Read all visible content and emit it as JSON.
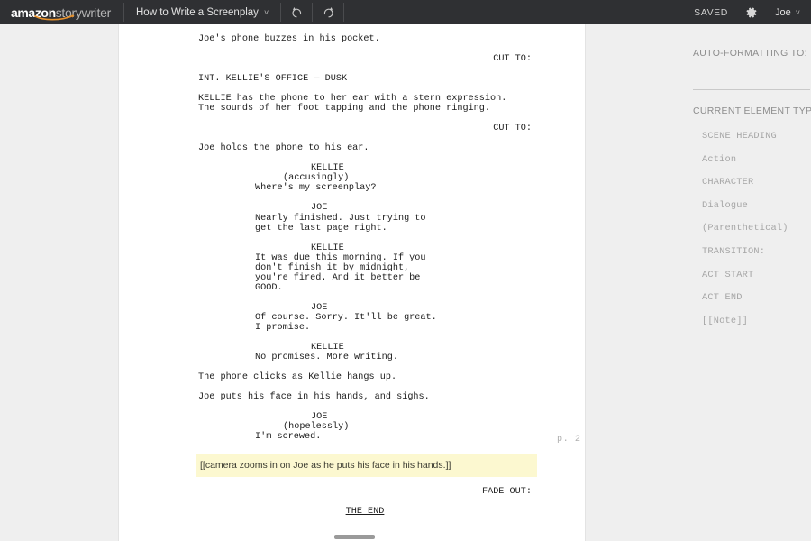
{
  "header": {
    "brand_primary": "amazon",
    "brand_secondary": "storywriter",
    "document_title": "How to Write a Screenplay",
    "title_chevron": "˅",
    "undo_label": "undo-arrow",
    "redo_label": "redo-arrow",
    "save_status": "SAVED",
    "settings_label": "gear",
    "user_name": "Joe",
    "user_chevron": "˅"
  },
  "script": {
    "page_number": "p. 2",
    "lines": [
      {
        "type": "action",
        "text": "Joe's phone buzzes in his pocket."
      },
      {
        "type": "transition",
        "text": "CUT TO:"
      },
      {
        "type": "scene",
        "text": "INT. KELLIE'S OFFICE — DUSK"
      },
      {
        "type": "action",
        "text": "KELLIE has the phone to her ear with a stern expression.\nThe sounds of her foot tapping and the phone ringing."
      },
      {
        "type": "transition",
        "text": "CUT TO:"
      },
      {
        "type": "action",
        "text": "Joe holds the phone to his ear."
      },
      {
        "type": "character",
        "text": "KELLIE"
      },
      {
        "type": "paren",
        "text": "(accusingly)"
      },
      {
        "type": "dialogue",
        "text": "Where's my screenplay?"
      },
      {
        "type": "character",
        "text": "JOE"
      },
      {
        "type": "dialogue",
        "text": "Nearly finished. Just trying to\nget the last page right."
      },
      {
        "type": "character",
        "text": "KELLIE"
      },
      {
        "type": "dialogue",
        "text": "It was due this morning. If you\ndon't finish it by midnight,\nyou're fired. And it better be\nGOOD."
      },
      {
        "type": "character",
        "text": "JOE"
      },
      {
        "type": "dialogue",
        "text": "Of course. Sorry. It'll be great.\nI promise."
      },
      {
        "type": "character",
        "text": "KELLIE"
      },
      {
        "type": "dialogue",
        "text": "No promises. More writing."
      },
      {
        "type": "action",
        "text": "The phone clicks as Kellie hangs up."
      },
      {
        "type": "action",
        "text": "Joe puts his face in his hands, and sighs."
      },
      {
        "type": "character",
        "text": "JOE"
      },
      {
        "type": "paren",
        "text": "(hopelessly)"
      },
      {
        "type": "dialogue",
        "text": "I'm screwed."
      },
      {
        "type": "note",
        "text": "[[camera zooms in on Joe as he puts his face in his hands.]]"
      },
      {
        "type": "transition",
        "text": "FADE OUT:"
      },
      {
        "type": "center_underline",
        "text": "THE END"
      }
    ]
  },
  "sidebar": {
    "auto_formatting_heading": "AUTO-FORMATTING TO:",
    "auto_formatting_value": "",
    "current_element_heading": "CURRENT ELEMENT TYPE",
    "element_types": [
      {
        "label": "SCENE HEADING"
      },
      {
        "label": "Action"
      },
      {
        "label": "CHARACTER"
      },
      {
        "label": "Dialogue"
      },
      {
        "label": "(Parenthetical)"
      },
      {
        "label": "TRANSITION:"
      },
      {
        "label": "ACT START"
      },
      {
        "label": "ACT END"
      },
      {
        "label": "[[Note]]"
      }
    ]
  },
  "colors": {
    "header_bg": "#2f3033",
    "workspace_bg": "#efefef",
    "page_bg": "#ffffff",
    "note_highlight": "#fcf8d0",
    "muted_text": "#8d8d8d"
  }
}
